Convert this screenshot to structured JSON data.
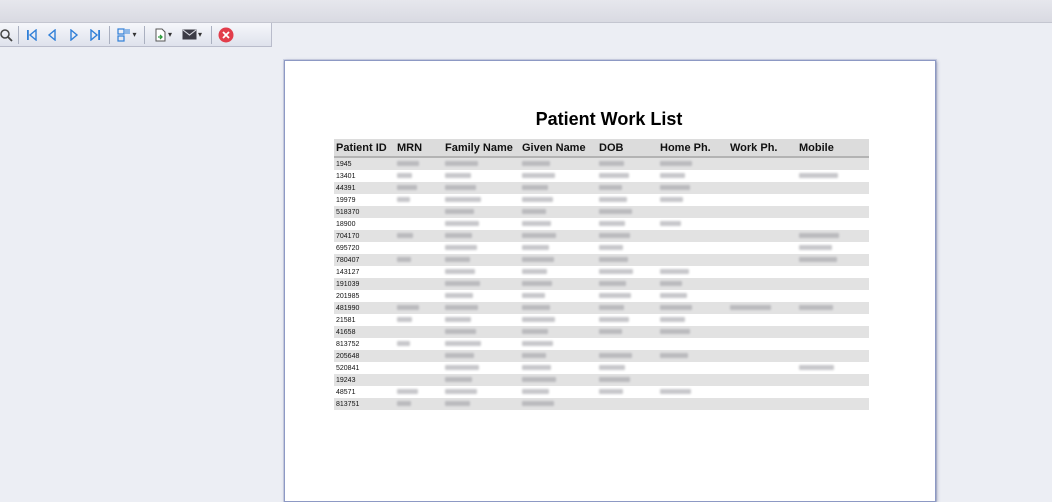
{
  "toolbar": {
    "buttons": [
      "zoom-icon",
      "first-page-icon",
      "previous-page-icon",
      "next-page-icon",
      "last-page-icon",
      "page-layout-icon",
      "export-icon",
      "email-icon",
      "close-icon"
    ]
  },
  "report": {
    "title": "Patient Work List",
    "columns": [
      "Patient ID",
      "MRN",
      "Family Name",
      "Given Name",
      "DOB",
      "Home Ph.",
      "Work Ph.",
      "Mobile"
    ],
    "patient_ids": [
      "1945",
      "13401",
      "44391",
      "19979",
      "518370",
      "18900",
      "704170",
      "695720",
      "780407",
      "143127",
      "191039",
      "201985",
      "481990",
      "21581",
      "41658",
      "813752",
      "205648",
      "520841",
      "19243",
      "48571",
      "813751"
    ]
  },
  "colors": {
    "header_bg": "#dcdcdc",
    "alt_row_bg": "#e2e2e2",
    "close_red": "#e23d4b",
    "nav_blue": "#2f7fd8"
  }
}
